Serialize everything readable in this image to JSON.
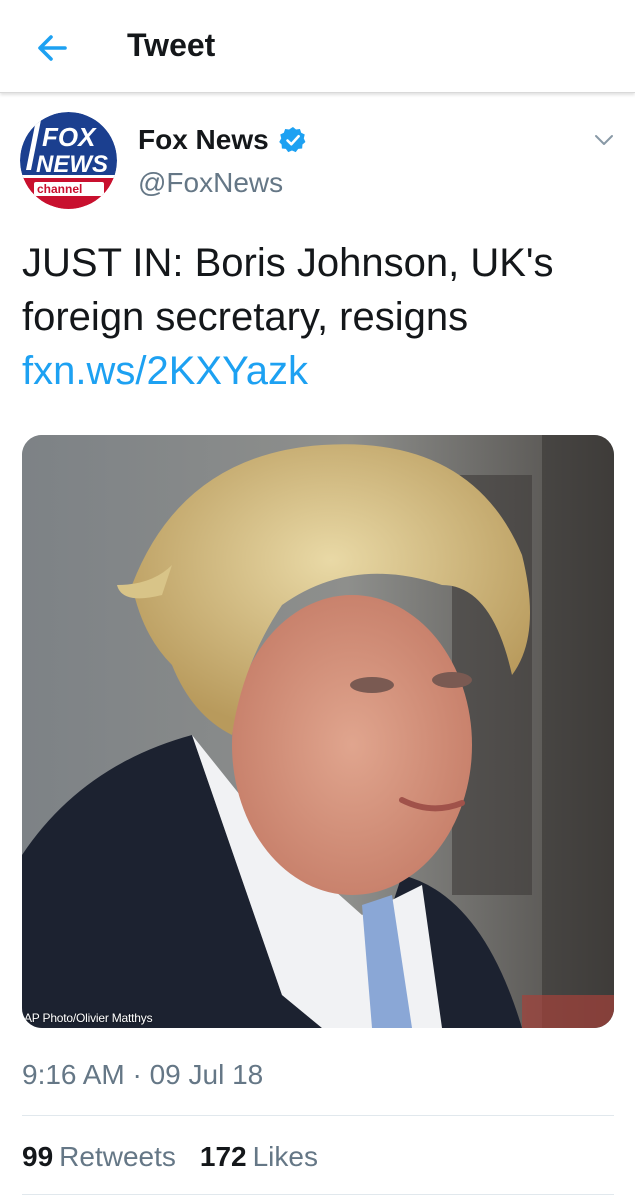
{
  "header": {
    "title": "Tweet",
    "back_icon": "arrow-left-icon"
  },
  "colors": {
    "accent": "#1da1f2",
    "text_primary": "#14171a",
    "text_secondary": "#657786",
    "divider": "#e1e8ed"
  },
  "tweet": {
    "author": {
      "name": "Fox News",
      "handle": "@FoxNews",
      "verified": true,
      "avatar_lines": [
        "FOX",
        "NEWS",
        "channel"
      ]
    },
    "text": "JUST IN: Boris Johnson, UK's foreign secretary, resigns",
    "link": "fxn.ws/2KXYazk",
    "media": {
      "credit": "AP Photo/Olivier Matthys"
    },
    "timestamp": "9:16 AM · 09 Jul 18",
    "stats": {
      "retweets_count": "99",
      "retweets_label": "Retweets",
      "likes_count": "172",
      "likes_label": "Likes"
    }
  }
}
